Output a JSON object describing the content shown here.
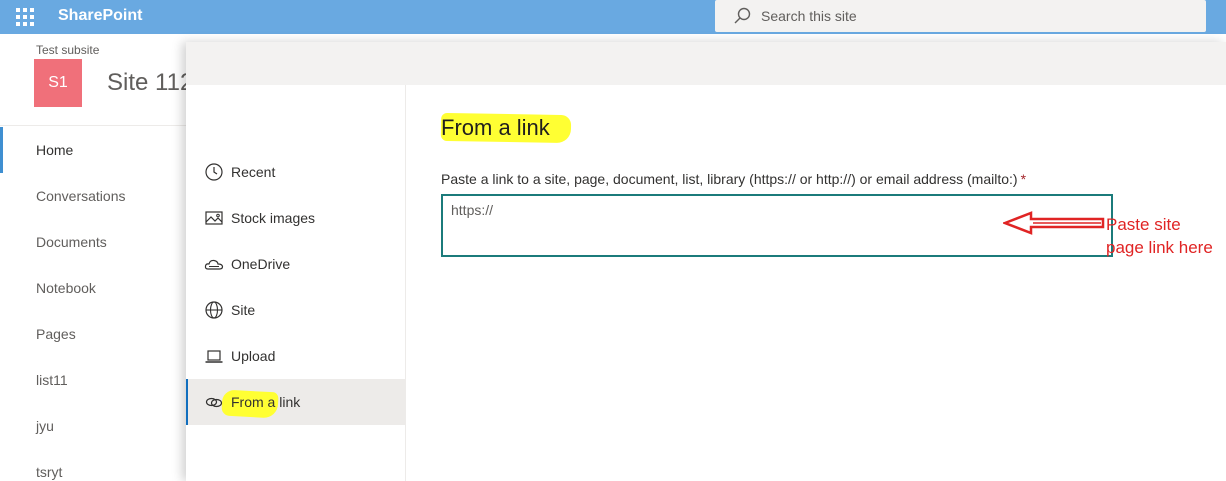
{
  "suite_bar": {
    "brand": "SharePoint",
    "search_placeholder": "Search this site",
    "color": "#69a9e1"
  },
  "site": {
    "subsite_label": "Test subsite",
    "logo_initials": "S1",
    "logo_color": "#f0707a",
    "title": "Site 112"
  },
  "left_nav": {
    "items": [
      {
        "label": "Home",
        "active": true
      },
      {
        "label": "Conversations"
      },
      {
        "label": "Documents"
      },
      {
        "label": "Notebook"
      },
      {
        "label": "Pages"
      },
      {
        "label": "list11"
      },
      {
        "label": "jyu"
      },
      {
        "label": "tsryt"
      }
    ]
  },
  "panel": {
    "nav": [
      {
        "label": "Recent",
        "icon": "clock-icon"
      },
      {
        "label": "Stock images",
        "icon": "image-icon"
      },
      {
        "label": "OneDrive",
        "icon": "cloud-icon"
      },
      {
        "label": "Site",
        "icon": "globe-icon"
      },
      {
        "label": "Upload",
        "icon": "laptop-icon"
      },
      {
        "label": "From a link",
        "icon": "link-icon",
        "selected": true
      }
    ],
    "content_title": "From a link",
    "field_label": "Paste a link to a site, page, document, list, library (https:// or http://) or email address (mailto:)",
    "required_marker": "*",
    "input_value": "https://"
  },
  "annotation": {
    "line1": "Paste site",
    "line2": "page link here",
    "color": "#e02424"
  }
}
